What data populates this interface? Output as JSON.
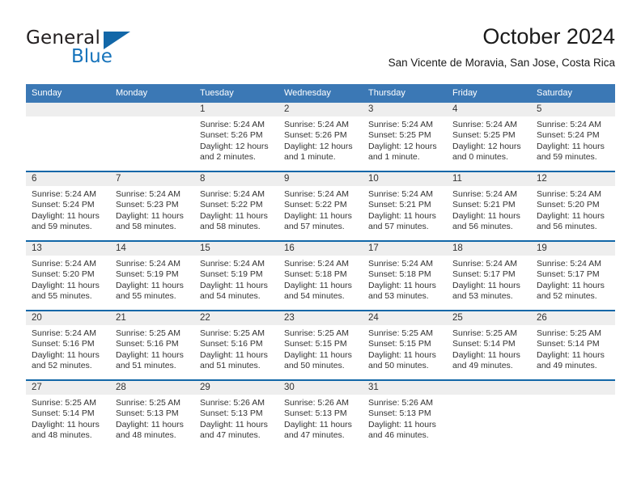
{
  "brand": {
    "name_part1": "General",
    "name_part2": "Blue"
  },
  "header": {
    "month_title": "October 2024",
    "location": "San Vicente de Moravia, San Jose, Costa Rica"
  },
  "colors": {
    "header_blue": "#3b78b5",
    "rule_blue": "#1267a8",
    "daynum_band": "#eeeeee",
    "brand_blue": "#1673bb"
  },
  "weekday_headers": [
    "Sunday",
    "Monday",
    "Tuesday",
    "Wednesday",
    "Thursday",
    "Friday",
    "Saturday"
  ],
  "labels": {
    "sunrise_prefix": "Sunrise: ",
    "sunset_prefix": "Sunset: ",
    "daylight_prefix": "Daylight: "
  },
  "weeks": [
    [
      {
        "day": "",
        "blank": true
      },
      {
        "day": "",
        "blank": true
      },
      {
        "day": "1",
        "sunrise": "Sunrise: 5:24 AM",
        "sunset": "Sunset: 5:26 PM",
        "daylight": "Daylight: 12 hours and 2 minutes."
      },
      {
        "day": "2",
        "sunrise": "Sunrise: 5:24 AM",
        "sunset": "Sunset: 5:26 PM",
        "daylight": "Daylight: 12 hours and 1 minute."
      },
      {
        "day": "3",
        "sunrise": "Sunrise: 5:24 AM",
        "sunset": "Sunset: 5:25 PM",
        "daylight": "Daylight: 12 hours and 1 minute."
      },
      {
        "day": "4",
        "sunrise": "Sunrise: 5:24 AM",
        "sunset": "Sunset: 5:25 PM",
        "daylight": "Daylight: 12 hours and 0 minutes."
      },
      {
        "day": "5",
        "sunrise": "Sunrise: 5:24 AM",
        "sunset": "Sunset: 5:24 PM",
        "daylight": "Daylight: 11 hours and 59 minutes."
      }
    ],
    [
      {
        "day": "6",
        "sunrise": "Sunrise: 5:24 AM",
        "sunset": "Sunset: 5:24 PM",
        "daylight": "Daylight: 11 hours and 59 minutes."
      },
      {
        "day": "7",
        "sunrise": "Sunrise: 5:24 AM",
        "sunset": "Sunset: 5:23 PM",
        "daylight": "Daylight: 11 hours and 58 minutes."
      },
      {
        "day": "8",
        "sunrise": "Sunrise: 5:24 AM",
        "sunset": "Sunset: 5:22 PM",
        "daylight": "Daylight: 11 hours and 58 minutes."
      },
      {
        "day": "9",
        "sunrise": "Sunrise: 5:24 AM",
        "sunset": "Sunset: 5:22 PM",
        "daylight": "Daylight: 11 hours and 57 minutes."
      },
      {
        "day": "10",
        "sunrise": "Sunrise: 5:24 AM",
        "sunset": "Sunset: 5:21 PM",
        "daylight": "Daylight: 11 hours and 57 minutes."
      },
      {
        "day": "11",
        "sunrise": "Sunrise: 5:24 AM",
        "sunset": "Sunset: 5:21 PM",
        "daylight": "Daylight: 11 hours and 56 minutes."
      },
      {
        "day": "12",
        "sunrise": "Sunrise: 5:24 AM",
        "sunset": "Sunset: 5:20 PM",
        "daylight": "Daylight: 11 hours and 56 minutes."
      }
    ],
    [
      {
        "day": "13",
        "sunrise": "Sunrise: 5:24 AM",
        "sunset": "Sunset: 5:20 PM",
        "daylight": "Daylight: 11 hours and 55 minutes."
      },
      {
        "day": "14",
        "sunrise": "Sunrise: 5:24 AM",
        "sunset": "Sunset: 5:19 PM",
        "daylight": "Daylight: 11 hours and 55 minutes."
      },
      {
        "day": "15",
        "sunrise": "Sunrise: 5:24 AM",
        "sunset": "Sunset: 5:19 PM",
        "daylight": "Daylight: 11 hours and 54 minutes."
      },
      {
        "day": "16",
        "sunrise": "Sunrise: 5:24 AM",
        "sunset": "Sunset: 5:18 PM",
        "daylight": "Daylight: 11 hours and 54 minutes."
      },
      {
        "day": "17",
        "sunrise": "Sunrise: 5:24 AM",
        "sunset": "Sunset: 5:18 PM",
        "daylight": "Daylight: 11 hours and 53 minutes."
      },
      {
        "day": "18",
        "sunrise": "Sunrise: 5:24 AM",
        "sunset": "Sunset: 5:17 PM",
        "daylight": "Daylight: 11 hours and 53 minutes."
      },
      {
        "day": "19",
        "sunrise": "Sunrise: 5:24 AM",
        "sunset": "Sunset: 5:17 PM",
        "daylight": "Daylight: 11 hours and 52 minutes."
      }
    ],
    [
      {
        "day": "20",
        "sunrise": "Sunrise: 5:24 AM",
        "sunset": "Sunset: 5:16 PM",
        "daylight": "Daylight: 11 hours and 52 minutes."
      },
      {
        "day": "21",
        "sunrise": "Sunrise: 5:25 AM",
        "sunset": "Sunset: 5:16 PM",
        "daylight": "Daylight: 11 hours and 51 minutes."
      },
      {
        "day": "22",
        "sunrise": "Sunrise: 5:25 AM",
        "sunset": "Sunset: 5:16 PM",
        "daylight": "Daylight: 11 hours and 51 minutes."
      },
      {
        "day": "23",
        "sunrise": "Sunrise: 5:25 AM",
        "sunset": "Sunset: 5:15 PM",
        "daylight": "Daylight: 11 hours and 50 minutes."
      },
      {
        "day": "24",
        "sunrise": "Sunrise: 5:25 AM",
        "sunset": "Sunset: 5:15 PM",
        "daylight": "Daylight: 11 hours and 50 minutes."
      },
      {
        "day": "25",
        "sunrise": "Sunrise: 5:25 AM",
        "sunset": "Sunset: 5:14 PM",
        "daylight": "Daylight: 11 hours and 49 minutes."
      },
      {
        "day": "26",
        "sunrise": "Sunrise: 5:25 AM",
        "sunset": "Sunset: 5:14 PM",
        "daylight": "Daylight: 11 hours and 49 minutes."
      }
    ],
    [
      {
        "day": "27",
        "sunrise": "Sunrise: 5:25 AM",
        "sunset": "Sunset: 5:14 PM",
        "daylight": "Daylight: 11 hours and 48 minutes."
      },
      {
        "day": "28",
        "sunrise": "Sunrise: 5:25 AM",
        "sunset": "Sunset: 5:13 PM",
        "daylight": "Daylight: 11 hours and 48 minutes."
      },
      {
        "day": "29",
        "sunrise": "Sunrise: 5:26 AM",
        "sunset": "Sunset: 5:13 PM",
        "daylight": "Daylight: 11 hours and 47 minutes."
      },
      {
        "day": "30",
        "sunrise": "Sunrise: 5:26 AM",
        "sunset": "Sunset: 5:13 PM",
        "daylight": "Daylight: 11 hours and 47 minutes."
      },
      {
        "day": "31",
        "sunrise": "Sunrise: 5:26 AM",
        "sunset": "Sunset: 5:13 PM",
        "daylight": "Daylight: 11 hours and 46 minutes."
      },
      {
        "day": "",
        "blank": true
      },
      {
        "day": "",
        "blank": true
      }
    ]
  ]
}
